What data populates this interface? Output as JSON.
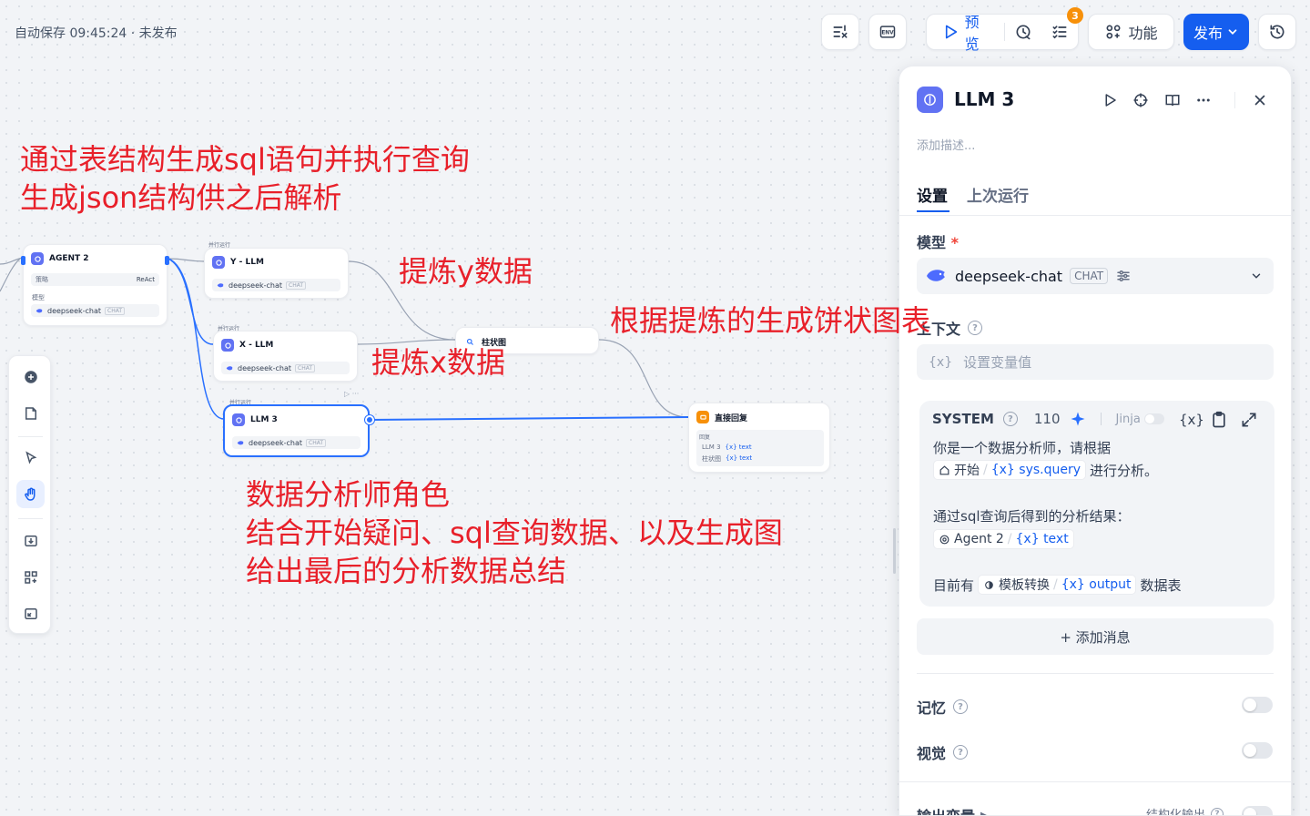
{
  "topbar": {
    "autosave": "自动保存 09:45:24 · 未发布",
    "preview": "预览",
    "checklist_badge": "3",
    "features": "功能",
    "publish": "发布",
    "env": "ENV"
  },
  "nodes": {
    "agent2": {
      "title": "AGENT 2",
      "strategy_label": "策略",
      "strategy_value": "ReAct",
      "model_label": "模型",
      "model": "deepseek-chat",
      "chip": "CHAT"
    },
    "yllm": {
      "group": "并行运行",
      "title": "Y - LLM",
      "model": "deepseek-chat",
      "chip": "CHAT"
    },
    "xllm": {
      "group": "并行运行",
      "title": "X - LLM",
      "model": "deepseek-chat",
      "chip": "CHAT"
    },
    "llm3": {
      "group": "并行运行",
      "title": "LLM 3",
      "model": "deepseek-chat",
      "chip": "CHAT"
    },
    "chart": {
      "title": "柱状图"
    },
    "answer": {
      "title": "直接回复",
      "label": "回复",
      "line1_node": "LLM 3",
      "line1_var": "{x} text",
      "line2_node": "柱状图",
      "line2_var": "{x} text"
    }
  },
  "annotations": {
    "top1": "通过表结构生成sql语句并执行查询",
    "top2": "生成json结构供之后解析",
    "ydata": "提炼y数据",
    "xdata": "提炼x数据",
    "pie": "根据提炼的生成饼状图表",
    "role1": "数据分析师角色",
    "role2": "结合开始疑问、sql查询数据、以及生成图",
    "role3": "给出最后的分析数据总结"
  },
  "panel": {
    "title": "LLM 3",
    "description_placeholder": "添加描述...",
    "tab_settings": "设置",
    "tab_last_run": "上次运行",
    "model_label": "模型",
    "required_mark": "*",
    "model_name": "deepseek-chat",
    "model_chip": "CHAT",
    "context_label": "上下文",
    "context_placeholder_icon": "{x}",
    "context_placeholder": "设置变量值",
    "system": {
      "role": "SYSTEM",
      "count": "110",
      "jinja": "Jinja",
      "var_icon": "{x}",
      "line1": "你是一个数据分析师，请根据",
      "ref1_node": "开始",
      "ref1_var": "{x} sys.query",
      "line2_after": "进行分析。",
      "line3": "通过sql查询后得到的分析结果：",
      "ref2_node": "Agent 2",
      "ref2_var": "{x} text",
      "line4_before": "目前有",
      "ref3_node": "模板转换",
      "ref3_var": "{x} output",
      "line4_after": "数据表"
    },
    "add_message": "+ 添加消息",
    "memory_label": "记忆",
    "vision_label": "视觉",
    "output_label": "输出变量",
    "structured_label": "结构化输出"
  }
}
